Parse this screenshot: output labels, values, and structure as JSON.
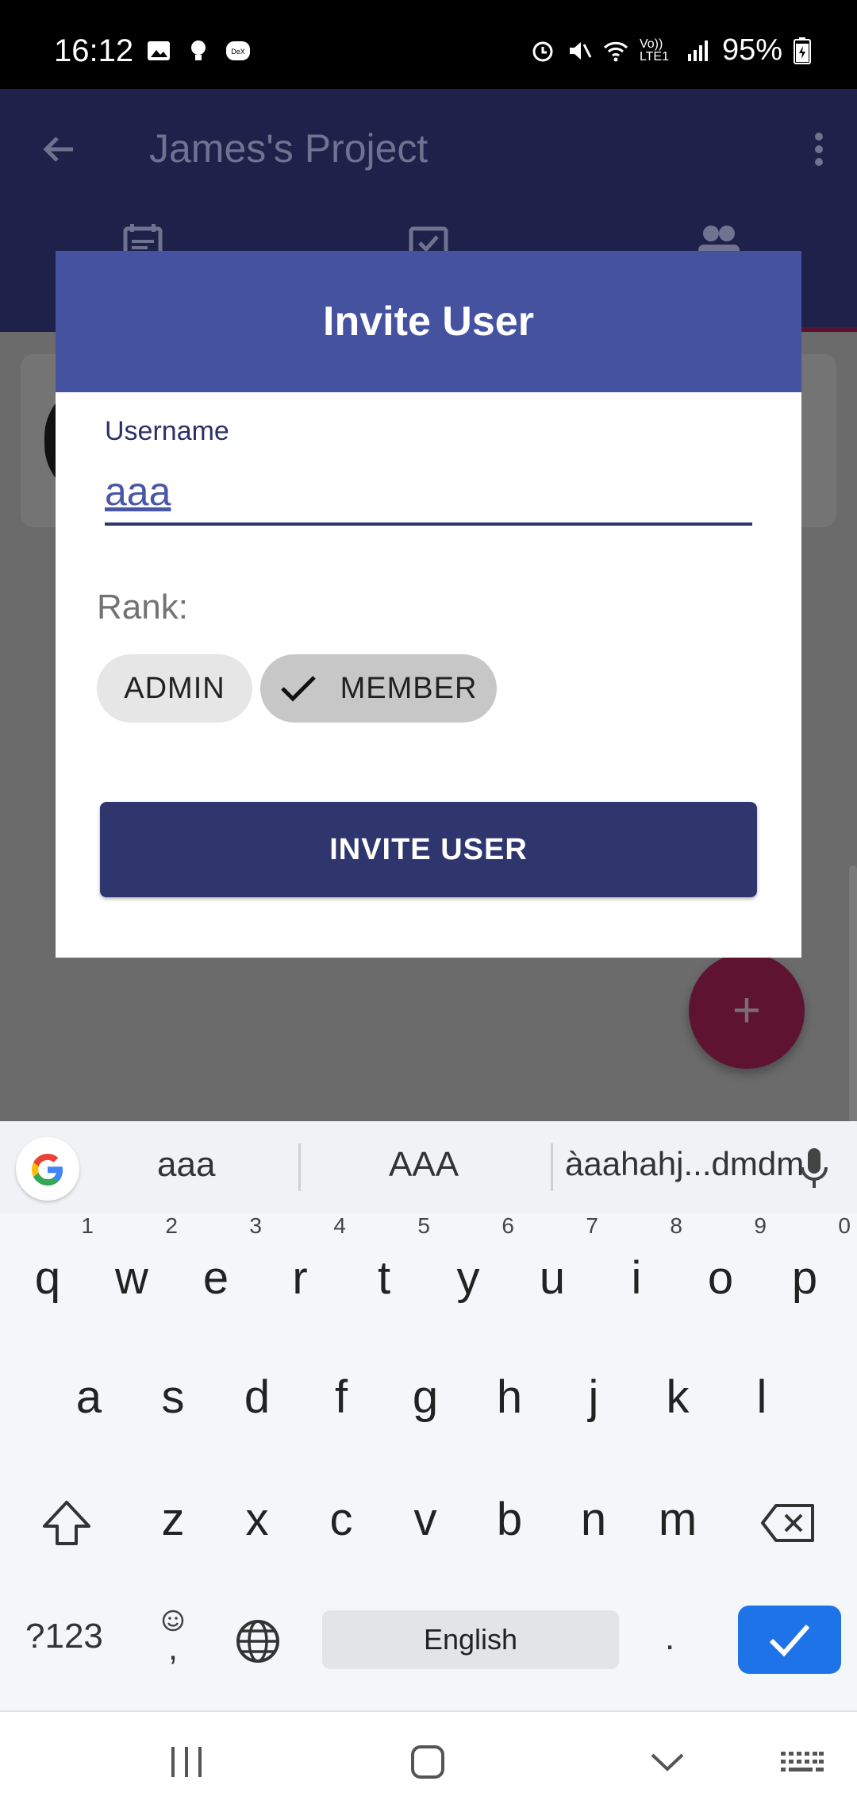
{
  "status_bar": {
    "time": "16:12",
    "battery": "95%",
    "network": "Vo)) LTE1"
  },
  "appbar": {
    "title": "James's Project",
    "back_icon": "arrow-left-icon",
    "menu_icon": "more-vertical-icon",
    "tabs": [
      "tasks-icon",
      "calendar-check-icon",
      "people-icon"
    ]
  },
  "dialog": {
    "title": "Invite User",
    "username_label": "Username",
    "username_value": "aaa",
    "rank_label": "Rank:",
    "chips": [
      {
        "label": "ADMIN",
        "selected": false
      },
      {
        "label": "MEMBER",
        "selected": true
      }
    ],
    "button_label": "INVITE USER",
    "header_color": "#4552a0",
    "button_color": "#2f366d"
  },
  "keyboard": {
    "suggestions": [
      "aaa",
      "AAA",
      "àaahahj...dmdm"
    ],
    "row1": [
      "q",
      "w",
      "e",
      "r",
      "t",
      "y",
      "u",
      "i",
      "o",
      "p"
    ],
    "row1_numbers": [
      "1",
      "2",
      "3",
      "4",
      "5",
      "6",
      "7",
      "8",
      "9",
      "0"
    ],
    "row2": [
      "a",
      "s",
      "d",
      "f",
      "g",
      "h",
      "j",
      "k",
      "l"
    ],
    "row3": [
      "z",
      "x",
      "c",
      "v",
      "b",
      "n",
      "m"
    ],
    "symbols_key": "?123",
    "comma_key": ",",
    "space_label": "English",
    "period_key": ".",
    "enter_color": "#1f73e8"
  }
}
